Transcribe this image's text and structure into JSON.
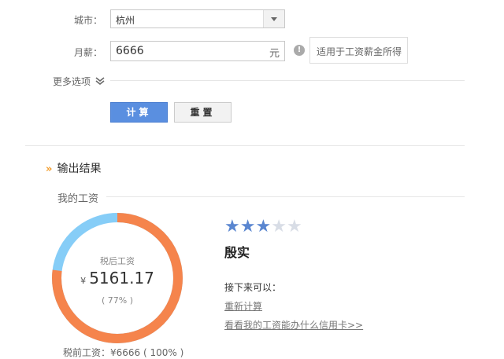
{
  "form": {
    "city_label": "城市：",
    "city_value": "杭州",
    "salary_label": "月薪：",
    "salary_value": "6666",
    "salary_unit": "元",
    "info_glyph": "!",
    "tip_text": "适用于工资薪金所得",
    "more_options": "更多选项",
    "calc_button": "计算",
    "reset_button": "重置"
  },
  "result": {
    "section_title": "输出结果",
    "subsection_title": "我的工资",
    "donut": {
      "label": "税后工资",
      "currency": "¥",
      "value": "5161.17",
      "percent_text": "( 77% )",
      "after_tax_fraction": 0.77,
      "after_tax_color": "#f5844c",
      "other_color": "#86cdf7"
    },
    "pre_tax_text": "税前工资：¥6666 ( 100% )",
    "rating": {
      "stars_filled": 3,
      "stars_total": 5,
      "filled_color": "#5a86d0",
      "empty_color": "#d8dde6"
    },
    "level": "殷实",
    "next_label": "接下来可以：",
    "link_recalc": "重新计算",
    "link_card": "看看我的工资能办什么信用卡>>"
  }
}
